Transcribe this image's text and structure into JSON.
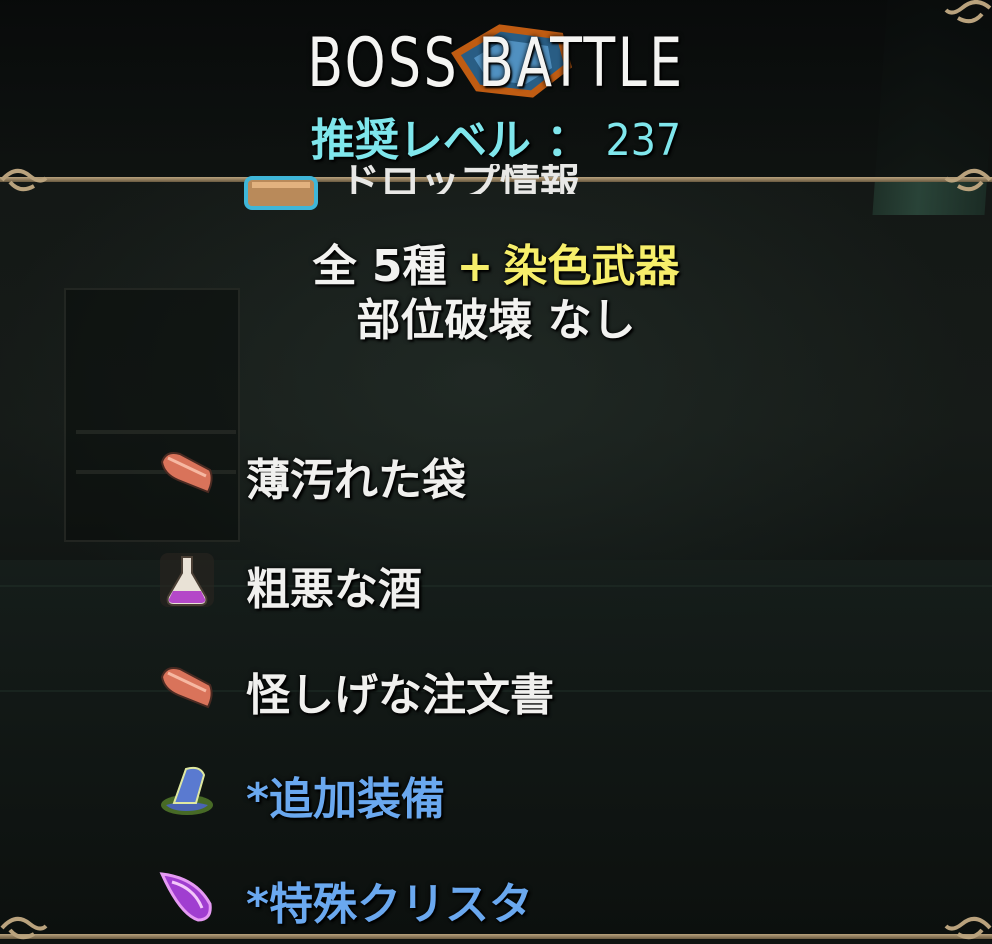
{
  "header": {
    "title": "BOSS BATTLE",
    "recommended_level_label": "推奨レベル ：",
    "recommended_level_value": "237"
  },
  "drops": {
    "partial_section_label": "ドロップ情報",
    "summary_count": "全 5種",
    "summary_plus": "+",
    "summary_dye": "染色武器",
    "part_break": "部位破壊 なし",
    "items": [
      {
        "label": "薄汚れた袋",
        "icon": "cloth-bag-icon",
        "color": "#f0f0ee"
      },
      {
        "label": "粗悪な酒",
        "icon": "potion-flask-icon",
        "color": "#f0f0ee"
      },
      {
        "label": "怪しげな注文書",
        "icon": "scroll-cloth-icon",
        "color": "#f0f0ee"
      },
      {
        "label": "*追加装備",
        "icon": "wizard-hat-icon",
        "color": "#6aa8ef"
      },
      {
        "label": "*特殊クリスタ",
        "icon": "purple-crystal-icon",
        "color": "#6aa8ef"
      }
    ]
  },
  "colors": {
    "title": "#f4f4f2",
    "level": "#7fe6ec",
    "dye_highlight": "#f6ee6a",
    "special_item": "#6aa8ef",
    "frame": "#b9a27d"
  }
}
